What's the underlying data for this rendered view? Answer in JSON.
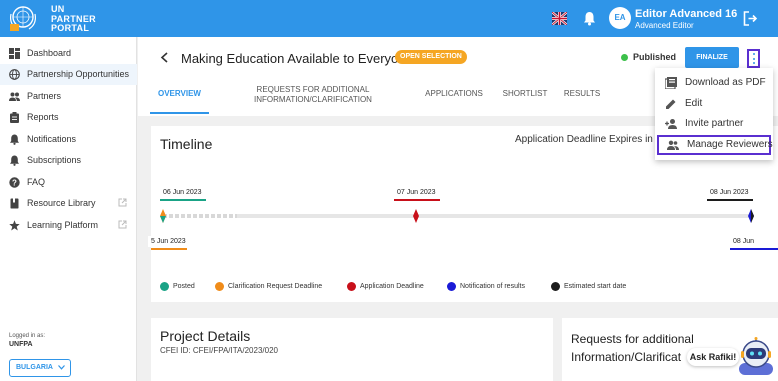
{
  "header": {
    "brand_lines": [
      "UN",
      "PARTNER",
      "PORTAL"
    ],
    "user_initials": "EA",
    "user_name": "Editor Advanced 16",
    "user_role": "Advanced Editor"
  },
  "sidebar": {
    "items": [
      {
        "label": "Dashboard",
        "icon": "dashboard-icon"
      },
      {
        "label": "Partnership Opportunities",
        "icon": "globe-icon",
        "active": true
      },
      {
        "label": "Partners",
        "icon": "people-icon"
      },
      {
        "label": "Reports",
        "icon": "clipboard-icon"
      },
      {
        "label": "Notifications",
        "icon": "bell-icon"
      },
      {
        "label": "Subscriptions",
        "icon": "bell-list-icon"
      },
      {
        "label": "FAQ",
        "icon": "help-icon"
      },
      {
        "label": "Resource Library",
        "icon": "book-icon",
        "external": true
      },
      {
        "label": "Learning Platform",
        "icon": "star-icon",
        "external": true
      }
    ],
    "logged_in_as": "Logged in as:",
    "organization": "UNFPA",
    "country": "BULGARIA"
  },
  "page": {
    "title": "Making Education Available to Everyone",
    "status": "OPEN SELECTION",
    "published_label": "Published",
    "finalize_label": "FINALIZE"
  },
  "tabs": [
    {
      "label": "OVERVIEW",
      "active": true
    },
    {
      "label": "REQUESTS FOR ADDITIONAL INFORMATION/CLARIFICATION"
    },
    {
      "label": "APPLICATIONS"
    },
    {
      "label": "SHORTLIST"
    },
    {
      "label": "RESULTS"
    }
  ],
  "timeline": {
    "title": "Timeline",
    "deadline_text": "Application Deadline Expires in 1 d",
    "chips": {
      "posted": "06 Jun 2023",
      "posted_clipped": "5 Jun 2023",
      "application": "07 Jun 2023",
      "estimated": "08 Jun 2023",
      "notification_clipped": "08 Jun"
    },
    "legend": [
      {
        "label": "Posted",
        "color": "#1aa386"
      },
      {
        "label": "Clarification Request Deadline",
        "color": "#f08c1a"
      },
      {
        "label": "Application Deadline",
        "color": "#c8101a"
      },
      {
        "label": "Notification of results",
        "color": "#1a1ad6"
      },
      {
        "label": "Estimated start date",
        "color": "#1c1c1c"
      }
    ]
  },
  "project_details": {
    "title": "Project Details",
    "cfei_id": "CFEI ID: CFEI/FPA/ITA/2023/020"
  },
  "requests_card": {
    "title_line1": "Requests for additional",
    "title_line2": "Information/Clarificat"
  },
  "menu": {
    "items": [
      {
        "label": "Download as PDF",
        "icon": "pdf-icon"
      },
      {
        "label": "Edit",
        "icon": "pencil-icon"
      },
      {
        "label": "Invite partner",
        "icon": "person-add-icon"
      },
      {
        "label": "Manage Reviewers",
        "icon": "group-icon"
      }
    ]
  },
  "assistant": {
    "label": "Ask Rafiki!"
  }
}
